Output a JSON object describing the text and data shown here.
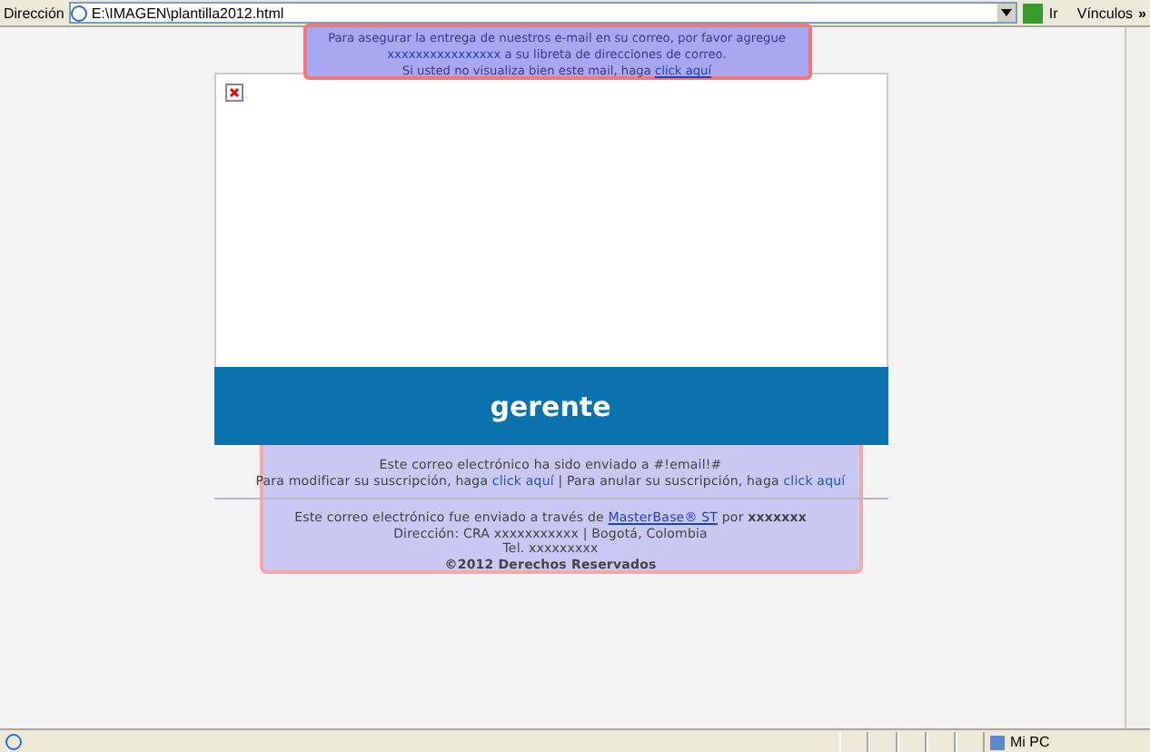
{
  "address_bar": {
    "label": "Dirección",
    "value": "E:\\IMAGEN\\plantilla2012.html",
    "go": "Ir",
    "links": "Vínculos",
    "more": "»"
  },
  "banner": {
    "line1": "Para asegurar la entrega de nuestros e-mail en su correo, por favor agregue",
    "address": "xxxxxxxxxxxxxxxx",
    "line2": " a su libreta de direcciones de correo.",
    "line3": "Si usted no visualiza bien este mail, haga ",
    "link": "click aquí"
  },
  "header": {
    "title": "gerente"
  },
  "footer": {
    "sent_to": "Este correo electrónico ha sido enviado a #!email!#",
    "modify": "Para modificar su suscripción, haga ",
    "modify_link": "click aquí",
    "sep": " | Para anular su suscripción, haga ",
    "cancel_link": "click aquí",
    "via": "Este correo electrónico fue enviado a través de ",
    "via_link": "MasterBase® ST",
    "by": " por ",
    "by_name": "xxxxxxx",
    "address": "Dirección: CRA xxxxxxxxxxx | Bogotá, Colombia",
    "phone": "Tel. xxxxxxxxx",
    "copyright": "©2012 Derechos Reservados"
  },
  "status_bar": {
    "zone": "Mi PC"
  }
}
